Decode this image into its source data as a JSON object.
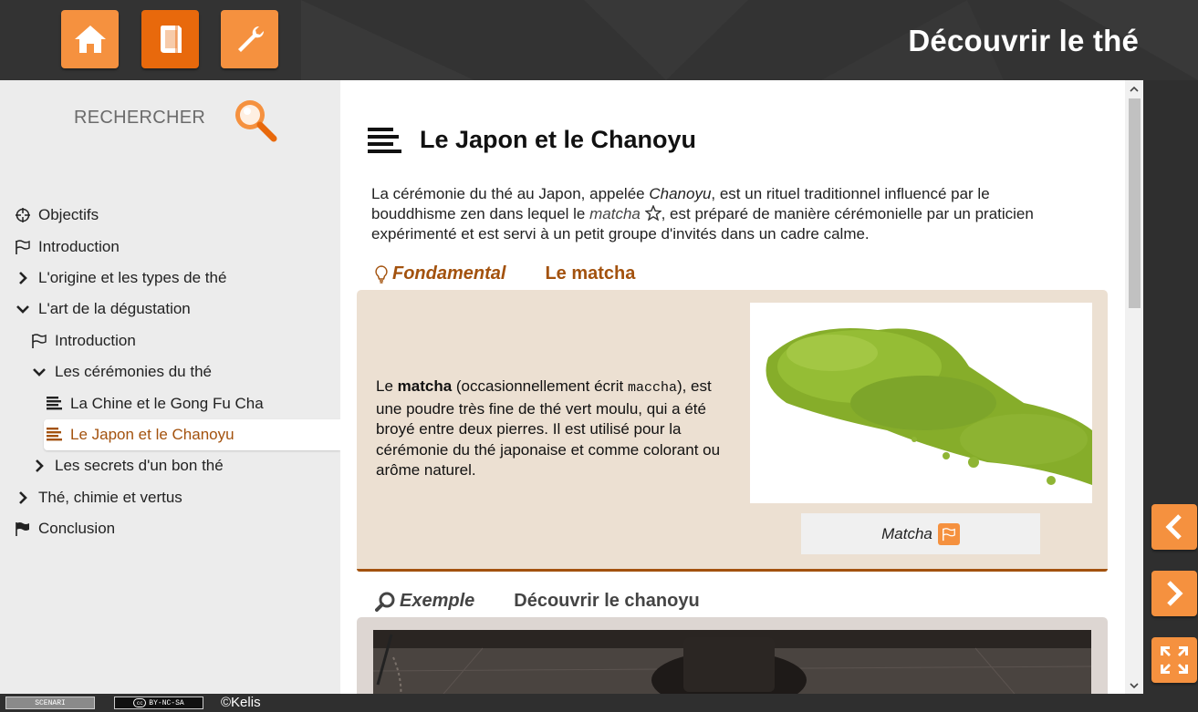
{
  "header": {
    "title": "Découvrir le thé",
    "buttons": [
      "home-icon",
      "book-icon",
      "wrench-icon"
    ]
  },
  "sidebar": {
    "search_label": "RECHERCHER",
    "items": [
      {
        "label": "Objectifs",
        "icon": "target-icon"
      },
      {
        "label": "Introduction",
        "icon": "flag-outline-icon"
      },
      {
        "label": "L'origine et les types de thé",
        "icon": "chevron-right-icon"
      },
      {
        "label": "L'art de la dégustation",
        "icon": "chevron-down-icon"
      },
      {
        "label": "Introduction",
        "icon": "flag-outline-icon"
      },
      {
        "label": "Les cérémonies du thé",
        "icon": "chevron-down-icon"
      },
      {
        "label": "La Chine et le Gong Fu Cha",
        "icon": "lines-icon"
      },
      {
        "label": "Le Japon et le Chanoyu",
        "icon": "lines-icon",
        "active": true
      },
      {
        "label": "Les secrets d'un bon thé",
        "icon": "chevron-right-icon"
      },
      {
        "label": "Thé, chimie et vertus",
        "icon": "chevron-right-icon"
      },
      {
        "label": "Conclusion",
        "icon": "flag-filled-icon"
      }
    ]
  },
  "content": {
    "title": "Le Japon et le Chanoyu",
    "intro": {
      "p1": "La cérémonie du thé au Japon, appelée ",
      "chanoyu": "Chanoyu",
      "p2": ", est un rituel traditionnel influencé par le bouddhisme zen dans lequel le ",
      "matcha": "matcha",
      "p3": ", est préparé de manière cérémonielle par un praticien expérimenté et est servi à un petit groupe d'invités dans un cadre calme."
    },
    "fondamental": {
      "label": "Fondamental",
      "title": "Le matcha",
      "text": {
        "a": "Le ",
        "b": "matcha",
        "c": " (occasionnellement écrit ",
        "d": "maccha",
        "e": "), est une poudre très fine de thé vert moulu, qui a été broyé entre deux pierres. Il est utilisé pour la cérémonie du thé japonaise et comme colorant ou arôme naturel."
      },
      "caption": "Matcha"
    },
    "exemple": {
      "label": "Exemple",
      "title": "Découvrir le chanoyu"
    }
  },
  "footer": {
    "badge1": "SCENARI",
    "badge2": "BY-NC-SA",
    "copyright": "©Kelis"
  },
  "colors": {
    "accent": "#f5913f",
    "accent_dark": "#e8690c",
    "brown": "#a3520e",
    "header_bg": "#333333"
  }
}
